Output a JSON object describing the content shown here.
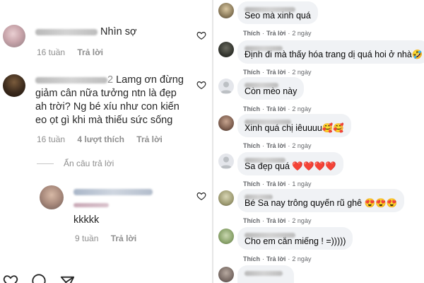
{
  "instagram": {
    "comments": [
      {
        "text": "Nhìn sợ",
        "time": "16 tuần",
        "reply": "Trả lời"
      },
      {
        "username_visible": "2",
        "text_line1": "Lamg ơn đừng",
        "text_line2": "giảm cân nữa tưởng ntn là đẹp",
        "text_line3": "ah trời? Ng bé xíu như con kiến",
        "text_line4": "eo ọt gì khi mà thiếu sức sống",
        "time": "16 tuần",
        "likes": "4 lượt thích",
        "reply": "Trả lời"
      }
    ],
    "hide_replies": "Ẩn câu trả lời",
    "reply_comment": {
      "text": "kkkkk",
      "time": "9 tuần",
      "reply": "Trả lời"
    }
  },
  "facebook": {
    "comments": [
      {
        "text": "Seo mà xinh quá",
        "like": "Thích",
        "reply": "Trả lời",
        "time": "2 ngày"
      },
      {
        "text": "Định đi mà thấy hóa trang dị quá hoi ở nhà🤣",
        "like": "Thích",
        "reply": "Trả lời",
        "time": "2 ngày"
      },
      {
        "text": "Còn mèo này",
        "like": "Thích",
        "reply": "Trả lời",
        "time": "2 ngày"
      },
      {
        "text": "Xinh quá chị iêuuuu🥰🥰",
        "like": "Thích",
        "reply": "Trả lời",
        "time": "2 ngày"
      },
      {
        "text": "Sa đẹp quá ❤️❤️❤️❤️",
        "like": "Thích",
        "reply": "Trả lời",
        "time": "1 ngày"
      },
      {
        "text": "Bé Sa nay trông quyến rũ ghê 😍😍😍",
        "like": "Thích",
        "reply": "Trả lời",
        "time": "2 ngày"
      },
      {
        "text": "Cho em cắn miếng ! =)))))",
        "like": "Thích",
        "reply": "Trả lời",
        "time": "2 ngày"
      }
    ]
  },
  "colors": {
    "text": "#262626",
    "meta": "#8e8e8e",
    "fb_bubble": "#f0f2f5",
    "fb_meta": "#65676b"
  }
}
